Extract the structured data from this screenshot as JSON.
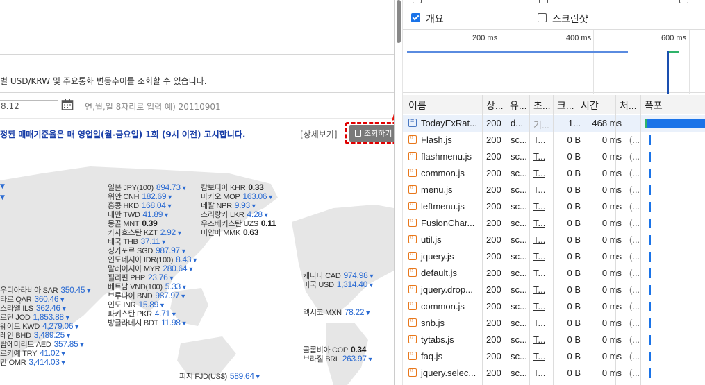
{
  "page": {
    "description": "별 USD/KRW 및 주요통화 변동추이를 조회할 수 있습니다.",
    "date_value": "8.12",
    "date_hint": "연,월,일 8자리로 입력 예) 20110901",
    "notice": "정된 매매기준율은 매 영업일(월-금요일) 1회 (9시 이전) 고시합니다.",
    "detail_link": "[상세보기]",
    "query_button": "조회하기"
  },
  "rates": [
    {
      "label": "일본 JPY(100)",
      "value": "894.73",
      "dir": "down"
    },
    {
      "label": "위안 CNH",
      "value": "182.69",
      "dir": "down"
    },
    {
      "label": "홍콩 HKD",
      "value": "168.04",
      "dir": "down"
    },
    {
      "label": "대만 TWD",
      "value": "41.89",
      "dir": "down"
    },
    {
      "label": "몽골 MNT",
      "value": "0.39",
      "dir": "flat"
    },
    {
      "label": "카자흐스탄 KZT",
      "value": "2.92",
      "dir": "down"
    },
    {
      "label": "태국 THB",
      "value": "37.11",
      "dir": "down"
    },
    {
      "label": "싱가포르 SGD",
      "value": "987.97",
      "dir": "down"
    },
    {
      "label": "인도네시아 IDR(100)",
      "value": "8.43",
      "dir": "down"
    },
    {
      "label": "말레이시아 MYR",
      "value": "280.64",
      "dir": "down"
    },
    {
      "label": "필리핀 PHP",
      "value": "23.76",
      "dir": "down"
    },
    {
      "label": "베트남 VND(100)",
      "value": "5.33",
      "dir": "down"
    },
    {
      "label": "브루나이 BND",
      "value": "987.97",
      "dir": "down"
    },
    {
      "label": "인도 INR",
      "value": "15.89",
      "dir": "down"
    },
    {
      "label": "파키스탄 PKR",
      "value": "4.71",
      "dir": "down"
    },
    {
      "label": "방글라데시 BDT",
      "value": "11.98",
      "dir": "down"
    },
    {
      "label": "캄보디아 KHR",
      "value": "0.33",
      "dir": "flat"
    },
    {
      "label": "마카오 MOP",
      "value": "163.06",
      "dir": "down"
    },
    {
      "label": "네팔 NPR",
      "value": "9.93",
      "dir": "down"
    },
    {
      "label": "스리랑카 LKR",
      "value": "4.28",
      "dir": "down"
    },
    {
      "label": "우즈베키스탄 UZS",
      "value": "0.11",
      "dir": "flat"
    },
    {
      "label": "미얀마 MMK",
      "value": "0.63",
      "dir": "flat"
    },
    {
      "label": "우디아라비아 SAR",
      "value": "350.45",
      "dir": "down"
    },
    {
      "label": "타르 QAR",
      "value": "360.46",
      "dir": "down"
    },
    {
      "label": "스라엘 ILS",
      "value": "362.46",
      "dir": "down"
    },
    {
      "label": "르단 JOD",
      "value": "1,853.88",
      "dir": "down"
    },
    {
      "label": "웨이트 KWD",
      "value": "4,279.06",
      "dir": "down"
    },
    {
      "label": "레인 BHD",
      "value": "3,489.25",
      "dir": "down"
    },
    {
      "label": "랍에미리트 AED",
      "value": "357.85",
      "dir": "down"
    },
    {
      "label": "르키예 TRY",
      "value": "41.02",
      "dir": "down"
    },
    {
      "label": "만 OMR",
      "value": "3,414.03",
      "dir": "down"
    },
    {
      "label": "캐나다 CAD",
      "value": "974.98",
      "dir": "down"
    },
    {
      "label": "미국 USD",
      "value": "1,314.40",
      "dir": "down"
    },
    {
      "label": "멕시코 MXN",
      "value": "78.22",
      "dir": "down"
    },
    {
      "label": "콜롬비아 COP",
      "value": "0.34",
      "dir": "flat"
    },
    {
      "label": "브라질 BRL",
      "value": "263.97",
      "dir": "down"
    },
    {
      "label": "피지 FJD(US$)",
      "value": "589.64",
      "dir": "down"
    }
  ],
  "devtools": {
    "options": {
      "overview": "개요",
      "screenshot": "스크린샷"
    },
    "timeline_labels": [
      "200 ms",
      "400 ms",
      "600 ms"
    ],
    "columns": [
      "이름",
      "상...",
      "유...",
      "초...",
      "크...",
      "시간",
      "처...",
      "폭포"
    ],
    "rows": [
      {
        "name": "TodayExRat...",
        "status": "200",
        "type": "d...",
        "initiator": "기...",
        "size": "1...",
        "time": "468 ms",
        "proc": "",
        "kind": "doc",
        "wf": "bar"
      },
      {
        "name": "Flash.js",
        "status": "200",
        "type": "sc...",
        "initiator": "T...",
        "size": "0 B",
        "time": "0 ms",
        "proc": "(...",
        "kind": "js",
        "wf": "tick"
      },
      {
        "name": "flashmenu.js",
        "status": "200",
        "type": "sc...",
        "initiator": "T...",
        "size": "0 B",
        "time": "0 ms",
        "proc": "(...",
        "kind": "js",
        "wf": "tick"
      },
      {
        "name": "common.js",
        "status": "200",
        "type": "sc...",
        "initiator": "T...",
        "size": "0 B",
        "time": "0 ms",
        "proc": "(...",
        "kind": "js",
        "wf": "tick"
      },
      {
        "name": "menu.js",
        "status": "200",
        "type": "sc...",
        "initiator": "T...",
        "size": "0 B",
        "time": "0 ms",
        "proc": "(...",
        "kind": "js",
        "wf": "tick"
      },
      {
        "name": "leftmenu.js",
        "status": "200",
        "type": "sc...",
        "initiator": "T...",
        "size": "0 B",
        "time": "0 ms",
        "proc": "(...",
        "kind": "js",
        "wf": "tick"
      },
      {
        "name": "FusionChar...",
        "status": "200",
        "type": "sc...",
        "initiator": "T...",
        "size": "0 B",
        "time": "0 ms",
        "proc": "(...",
        "kind": "js",
        "wf": "tick"
      },
      {
        "name": "util.js",
        "status": "200",
        "type": "sc...",
        "initiator": "T...",
        "size": "0 B",
        "time": "0 ms",
        "proc": "(...",
        "kind": "js",
        "wf": "tick"
      },
      {
        "name": "jquery.js",
        "status": "200",
        "type": "sc...",
        "initiator": "T...",
        "size": "0 B",
        "time": "0 ms",
        "proc": "(...",
        "kind": "js",
        "wf": "tick"
      },
      {
        "name": "default.js",
        "status": "200",
        "type": "sc...",
        "initiator": "T...",
        "size": "0 B",
        "time": "0 ms",
        "proc": "(...",
        "kind": "js",
        "wf": "tick"
      },
      {
        "name": "jquery.drop...",
        "status": "200",
        "type": "sc...",
        "initiator": "T...",
        "size": "0 B",
        "time": "0 ms",
        "proc": "(...",
        "kind": "js",
        "wf": "tick"
      },
      {
        "name": "common.js",
        "status": "200",
        "type": "sc...",
        "initiator": "T...",
        "size": "0 B",
        "time": "0 ms",
        "proc": "(...",
        "kind": "js",
        "wf": "tick"
      },
      {
        "name": "snb.js",
        "status": "200",
        "type": "sc...",
        "initiator": "T...",
        "size": "0 B",
        "time": "0 ms",
        "proc": "(...",
        "kind": "js",
        "wf": "tick"
      },
      {
        "name": "tytabs.js",
        "status": "200",
        "type": "sc...",
        "initiator": "T...",
        "size": "0 B",
        "time": "0 ms",
        "proc": "(...",
        "kind": "js",
        "wf": "tick"
      },
      {
        "name": "faq.js",
        "status": "200",
        "type": "sc...",
        "initiator": "T...",
        "size": "0 B",
        "time": "0 ms",
        "proc": "(...",
        "kind": "js",
        "wf": "tick"
      },
      {
        "name": "jquery.selec...",
        "status": "200",
        "type": "sc...",
        "initiator": "T...",
        "size": "0 B",
        "time": "0 ms",
        "proc": "(...",
        "kind": "js",
        "wf": "tick"
      }
    ]
  },
  "colors": {
    "accent": "#1a73e8",
    "notice": "#1a3fa8",
    "rate": "#2a6ad2",
    "highlight": "#e00000"
  }
}
